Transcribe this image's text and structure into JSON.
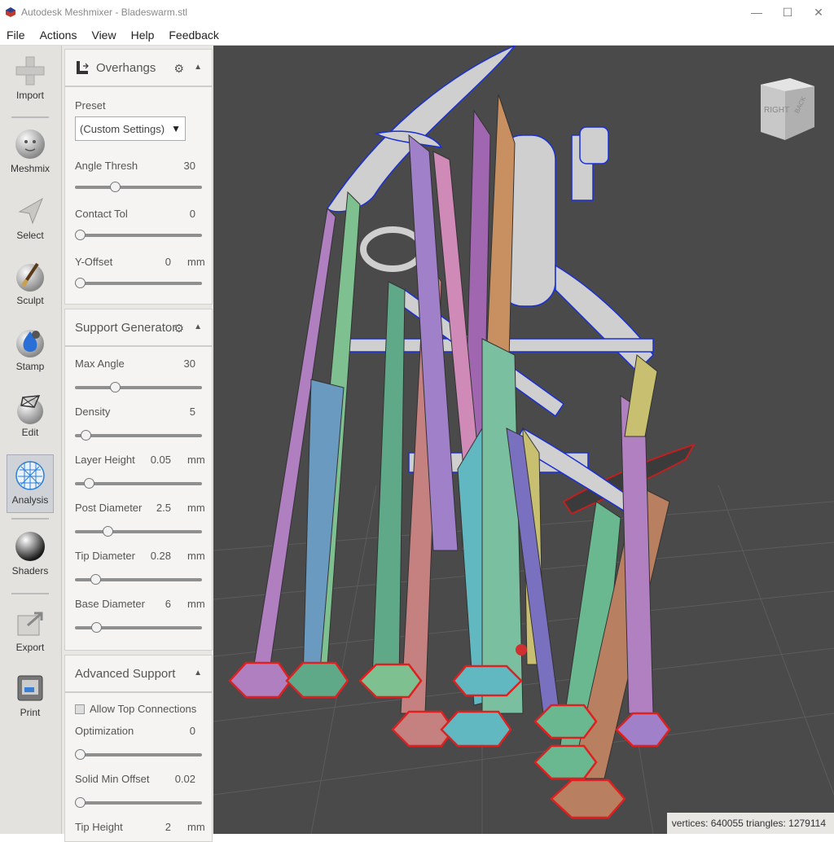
{
  "window": {
    "title": "Autodesk Meshmixer - Bladeswarm.stl",
    "controls": [
      "—",
      "☐",
      "✕"
    ]
  },
  "menu": [
    "File",
    "Actions",
    "View",
    "Help",
    "Feedback"
  ],
  "toolbar": {
    "tools": [
      {
        "label": "Import",
        "icon": "plus-icon"
      },
      {
        "label": "Meshmix",
        "icon": "face-sphere-icon"
      },
      {
        "label": "Select",
        "icon": "arrow-cursor-icon"
      },
      {
        "label": "Sculpt",
        "icon": "brush-sphere-icon"
      },
      {
        "label": "Stamp",
        "icon": "stamp-sphere-icon"
      },
      {
        "label": "Edit",
        "icon": "edit-sphere-icon"
      },
      {
        "label": "Analysis",
        "icon": "analysis-sphere-icon"
      },
      {
        "label": "Shaders",
        "icon": "shader-sphere-icon"
      },
      {
        "label": "Export",
        "icon": "export-icon"
      },
      {
        "label": "Print",
        "icon": "printer-icon"
      }
    ],
    "active": "Analysis"
  },
  "overhangs": {
    "title": "Overhangs",
    "preset_label": "Preset",
    "preset_value": "(Custom Settings)",
    "angle_label": "Angle Thresh",
    "angle_value": "30",
    "angle_frac": 0.3,
    "contact_label": "Contact Tol",
    "contact_value": "0",
    "contact_frac": 0.0,
    "yoffset_label": "Y-Offset",
    "yoffset_value": "0",
    "yoffset_unit": "mm",
    "yoffset_frac": 0.0
  },
  "support_generator": {
    "title": "Support Generator",
    "max_angle_label": "Max Angle",
    "max_angle_value": "30",
    "max_angle_frac": 0.3,
    "density_label": "Density",
    "density_value": "5",
    "density_frac": 0.05,
    "layer_label": "Layer Height",
    "layer_value": "0.05",
    "layer_unit": "mm",
    "layer_frac": 0.08,
    "post_label": "Post Diameter",
    "post_value": "2.5",
    "post_unit": "mm",
    "post_frac": 0.24,
    "tip_label": "Tip Diameter",
    "tip_value": "0.28",
    "tip_unit": "mm",
    "tip_frac": 0.13,
    "base_label": "Base Diameter",
    "base_value": "6",
    "base_unit": "mm",
    "base_frac": 0.14
  },
  "advanced_support": {
    "title": "Advanced Support",
    "allow_top_label": "Allow Top Connections",
    "optimization_label": "Optimization",
    "optimization_value": "0",
    "optimization_frac": 0.0,
    "solid_label": "Solid Min Offset",
    "solid_value": "0.02",
    "solid_frac": 0.0,
    "tip_height_label": "Tip Height",
    "tip_height_value": "2",
    "tip_height_unit": "mm"
  },
  "viewcube": {
    "right": "RIGHT",
    "back": "BACK"
  },
  "status": "vertices: 640055 triangles: 1279114",
  "colors": {
    "viewport_bg": "#4a4a4a",
    "panel_bg": "#f5f4f2",
    "toolbar_bg": "#e4e2df",
    "overhang_outline": "#1a2fd6",
    "base_outline": "#e02020"
  }
}
